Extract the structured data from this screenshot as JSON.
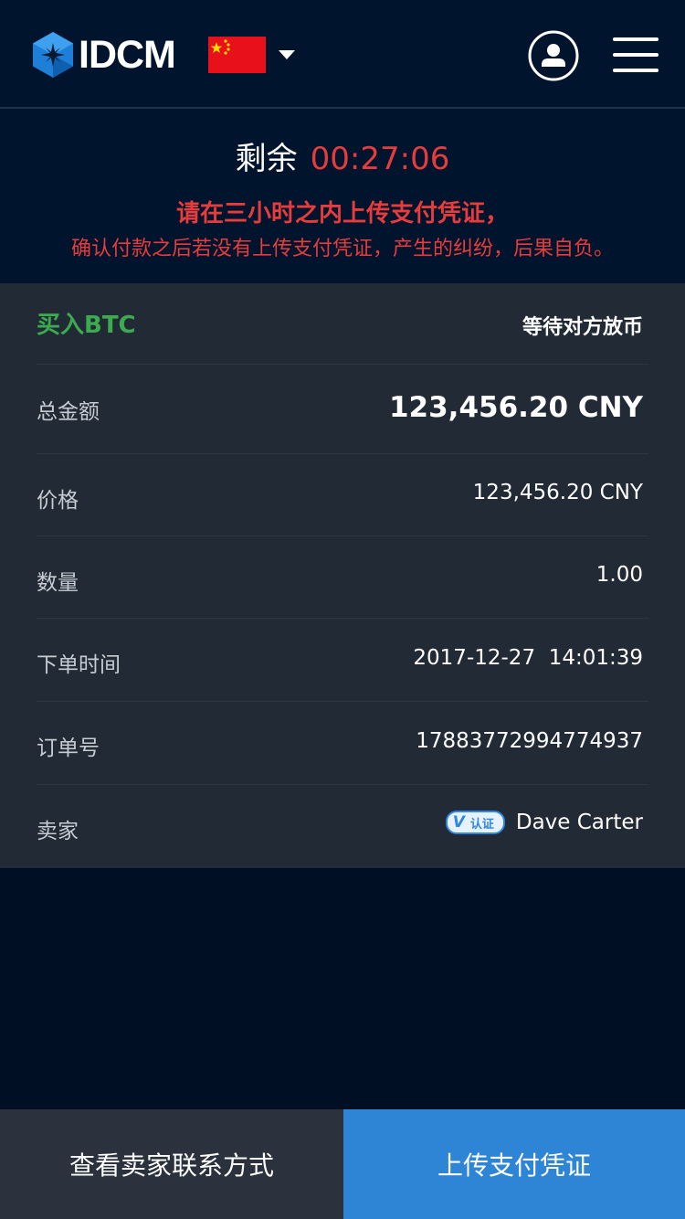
{
  "header": {
    "brand": "IDCM",
    "language_flag": "china-flag",
    "icons": [
      "idcm-logo-icon",
      "chevron-down-icon",
      "user-icon",
      "menu-icon"
    ]
  },
  "timer": {
    "label": "剩余",
    "remaining": "00:27:06",
    "warning_line1": "请在三小时之内上传支付凭证，",
    "warning_line2": "确认付款之后若没有上传支付凭证，产生的纠纷，后果自负。"
  },
  "order": {
    "type": "买入BTC",
    "status": "等待对方放币",
    "total_label": "总金额",
    "total_value": "123,456.20 CNY",
    "price_label": "价格",
    "price_value": "123,456.20 CNY",
    "quantity_label": "数量",
    "quantity_value": "1.00",
    "time_label": "下单时间",
    "time_value": "2017-12-27  14:01:39",
    "order_no_label": "订单号",
    "order_no_value": "17883772994774937",
    "seller_label": "卖家",
    "seller_badge": "认证",
    "seller_name": "Dave Carter"
  },
  "actions": {
    "contact_label": "查看卖家联系方式",
    "upload_label": "上传支付凭证"
  },
  "colors": {
    "background": "#000f23",
    "header": "#00152d",
    "card": "#212a35",
    "danger": "#e83b3b",
    "buy_green": "#3cab50",
    "primary_blue": "#2e84d5"
  }
}
